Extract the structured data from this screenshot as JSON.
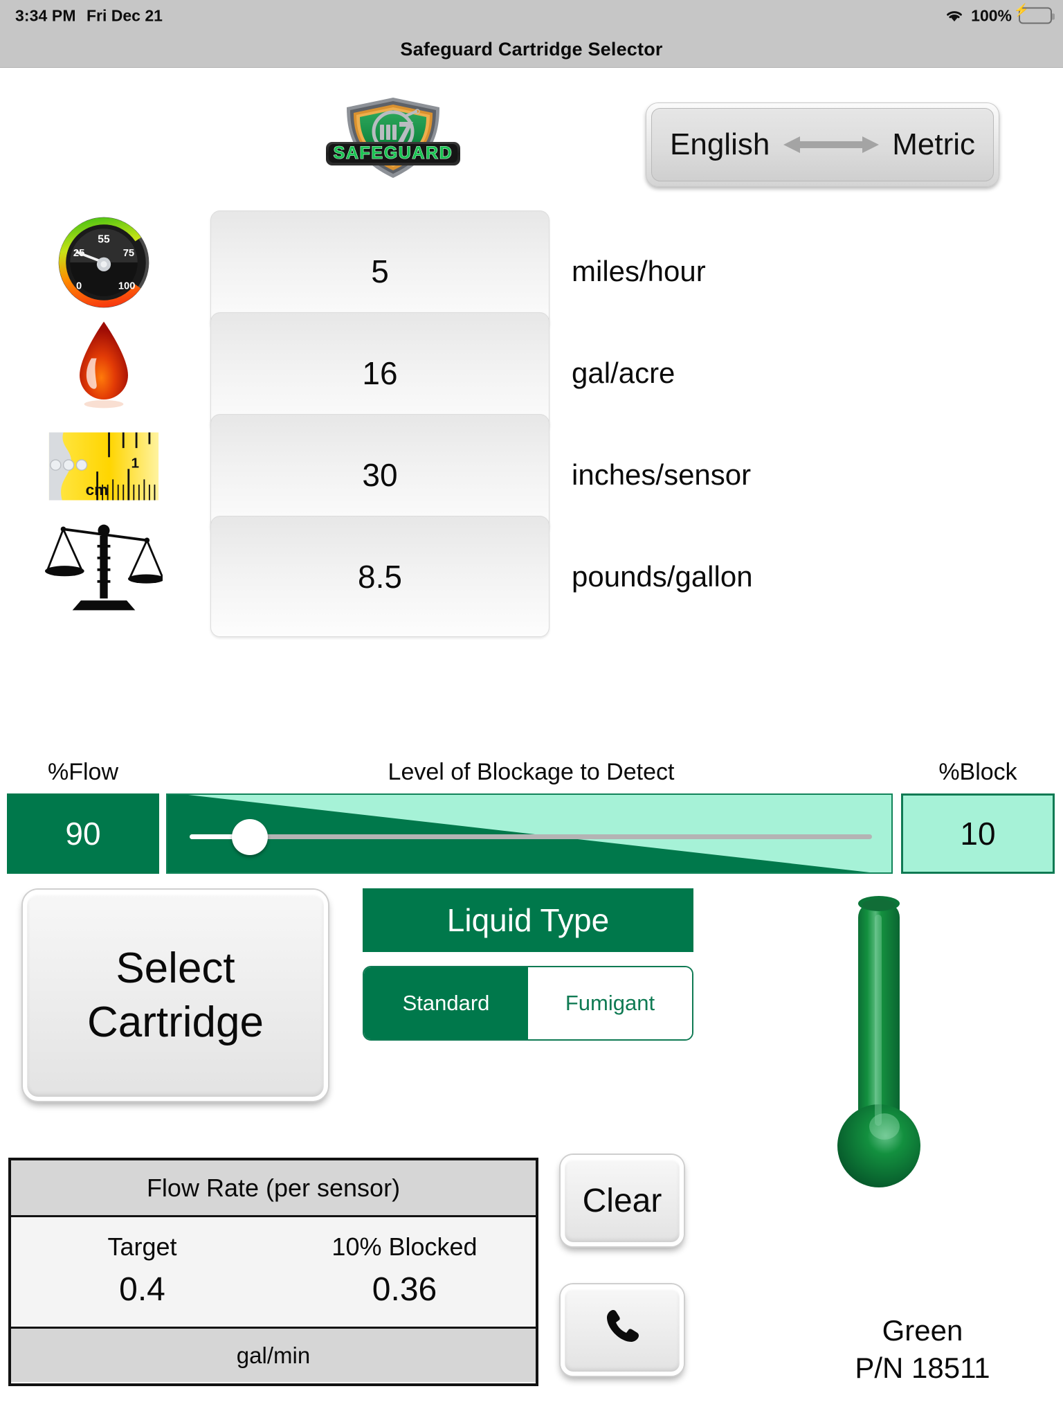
{
  "status_bar": {
    "time": "3:34 PM",
    "date": "Fri Dec 21",
    "battery_percent": "100%",
    "wifi_icon": "wifi-icon",
    "battery_icon": "battery-charging-icon"
  },
  "title_bar": {
    "title": "Safeguard Cartridge Selector"
  },
  "logo": {
    "brand_text": "SAFEGUARD",
    "monogram": "m7",
    "icon": "safeguard-shield-logo"
  },
  "unit_toggle": {
    "left_label": "English",
    "right_label": "Metric",
    "arrow_icon": "double-arrow-icon"
  },
  "inputs": [
    {
      "icon": "speedometer-icon",
      "value": "5",
      "unit": "miles/hour",
      "gauge_ticks": [
        "0",
        "25",
        "55",
        "75",
        "100"
      ]
    },
    {
      "icon": "droplet-icon",
      "value": "16",
      "unit": "gal/acre"
    },
    {
      "icon": "tape-measure-icon",
      "value": "30",
      "unit": "inches/sensor",
      "tape_marks": [
        "cm",
        "1"
      ]
    },
    {
      "icon": "balance-scale-icon",
      "value": "8.5",
      "unit": "pounds/gallon"
    }
  ],
  "blockage": {
    "flow_label": "%Flow",
    "flow_value": "90",
    "slider_title": "Level of Blockage to Detect",
    "block_label": "%Block",
    "block_value": "10",
    "slider_position_percent": 10
  },
  "select_cartridge": {
    "label": "Select\nCartridge",
    "line1": "Select",
    "line2": "Cartridge"
  },
  "liquid_type": {
    "header": "Liquid Type",
    "options": [
      {
        "label": "Standard",
        "selected": true
      },
      {
        "label": "Fumigant",
        "selected": false
      }
    ]
  },
  "cartridge_result": {
    "color_name": "Green",
    "part_number": "P/N 18511",
    "icon": "thermometer-cartridge-icon",
    "color_hex": "#11893f"
  },
  "flow_table": {
    "header": "Flow Rate (per sensor)",
    "columns": [
      "Target",
      "10% Blocked"
    ],
    "values": [
      "0.4",
      "0.36"
    ],
    "footer": "gal/min"
  },
  "actions": {
    "clear_label": "Clear",
    "call_icon": "phone-icon"
  },
  "colors": {
    "brand_green": "#00784b",
    "mint": "#a6f2d7",
    "chrome_gray": "#c6c6c6"
  }
}
